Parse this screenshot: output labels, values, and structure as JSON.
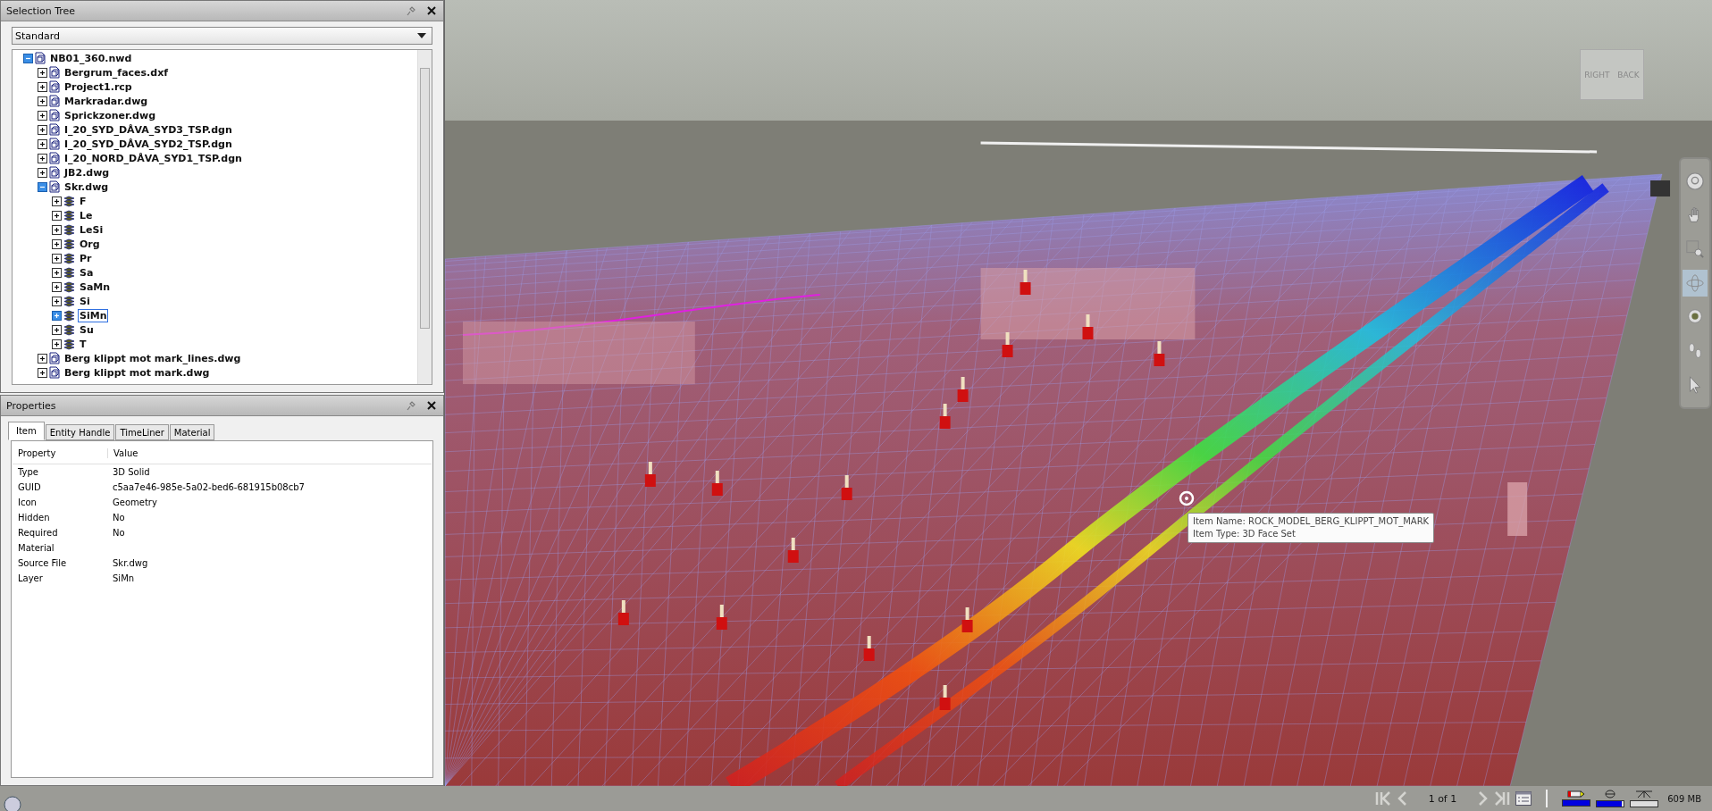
{
  "selection_tree": {
    "title": "Selection Tree",
    "dropdown": {
      "value": "Standard"
    },
    "items": [
      {
        "label": "NB01_360.nwd",
        "kind": "file",
        "expanded": true,
        "selected": false,
        "children": [
          {
            "label": "Bergrum_faces.dxf",
            "kind": "file",
            "expanded": false,
            "selected": false
          },
          {
            "label": "Project1.rcp",
            "kind": "file",
            "expanded": false,
            "selected": false
          },
          {
            "label": "Markradar.dwg",
            "kind": "file",
            "expanded": false,
            "selected": false
          },
          {
            "label": "Sprickzoner.dwg",
            "kind": "file",
            "expanded": false,
            "selected": false
          },
          {
            "label": "I_20_SYD_DÅVA_SYD3_TSP.dgn",
            "kind": "file",
            "expanded": false,
            "selected": false
          },
          {
            "label": "I_20_SYD_DÅVA_SYD2_TSP.dgn",
            "kind": "file",
            "expanded": false,
            "selected": false
          },
          {
            "label": "I_20_NORD_DÅVA_SYD1_TSP.dgn",
            "kind": "file",
            "expanded": false,
            "selected": false
          },
          {
            "label": "JB2.dwg",
            "kind": "file",
            "expanded": false,
            "selected": false
          },
          {
            "label": "Skr.dwg",
            "kind": "file",
            "expanded": true,
            "selected": false,
            "children": [
              {
                "label": "F",
                "kind": "layer",
                "expanded": false,
                "selected": false
              },
              {
                "label": "Le",
                "kind": "layer",
                "expanded": false,
                "selected": false
              },
              {
                "label": "LeSi",
                "kind": "layer",
                "expanded": false,
                "selected": false
              },
              {
                "label": "Org",
                "kind": "layer",
                "expanded": false,
                "selected": false
              },
              {
                "label": "Pr",
                "kind": "layer",
                "expanded": false,
                "selected": false
              },
              {
                "label": "Sa",
                "kind": "layer",
                "expanded": false,
                "selected": false
              },
              {
                "label": "SaMn",
                "kind": "layer",
                "expanded": false,
                "selected": false
              },
              {
                "label": "Si",
                "kind": "layer",
                "expanded": false,
                "selected": false
              },
              {
                "label": "SiMn",
                "kind": "layer",
                "expanded": false,
                "selected": true
              },
              {
                "label": "Su",
                "kind": "layer",
                "expanded": false,
                "selected": false
              },
              {
                "label": "T",
                "kind": "layer",
                "expanded": false,
                "selected": false
              }
            ]
          },
          {
            "label": "Berg klippt mot mark_lines.dwg",
            "kind": "file",
            "expanded": false,
            "selected": false
          },
          {
            "label": "Berg klippt mot mark.dwg",
            "kind": "file",
            "expanded": false,
            "selected": false
          }
        ]
      }
    ]
  },
  "properties": {
    "title": "Properties",
    "tabs": [
      {
        "label": "Item",
        "selected": true
      },
      {
        "label": "Entity Handle",
        "selected": false
      },
      {
        "label": "TimeLiner",
        "selected": false
      },
      {
        "label": "Material",
        "selected": false
      }
    ],
    "columns": [
      "Property",
      "Value"
    ],
    "rows": [
      {
        "property": "Type",
        "value": "3D Solid"
      },
      {
        "property": "GUID",
        "value": "c5aa7e46-985e-5a02-bed6-681915b08cb7"
      },
      {
        "property": "Icon",
        "value": "Geometry"
      },
      {
        "property": "Hidden",
        "value": "No"
      },
      {
        "property": "Required",
        "value": "No"
      },
      {
        "property": "Material"
      },
      {
        "property": "Source File",
        "value": "Skr.dwg"
      },
      {
        "property": "Layer",
        "value": "SiMn"
      }
    ]
  },
  "viewport": {
    "view_cube": {
      "faces": [
        "RIGHT",
        "BACK"
      ]
    },
    "tooltip": {
      "lines": [
        "Item Name: ROCK_MODEL_BERG_KLIPPT_MOT_MARK",
        "Item Type: 3D Face Set"
      ]
    },
    "nav_tools": [
      {
        "kind": "wheel",
        "selected": false
      },
      {
        "kind": "pan",
        "selected": false
      },
      {
        "kind": "zoom",
        "selected": false
      },
      {
        "kind": "orbit",
        "selected": true
      },
      {
        "kind": "look",
        "selected": false
      },
      {
        "kind": "walk",
        "selected": false
      },
      {
        "kind": "select",
        "selected": false
      }
    ]
  },
  "status_bar": {
    "page": "1 of 1",
    "meters": [
      {
        "kind": "pencil",
        "level": 1
      },
      {
        "kind": "disk",
        "level": 0.93
      },
      {
        "kind": "network",
        "level": 0
      }
    ],
    "memory": "609 MB"
  }
}
